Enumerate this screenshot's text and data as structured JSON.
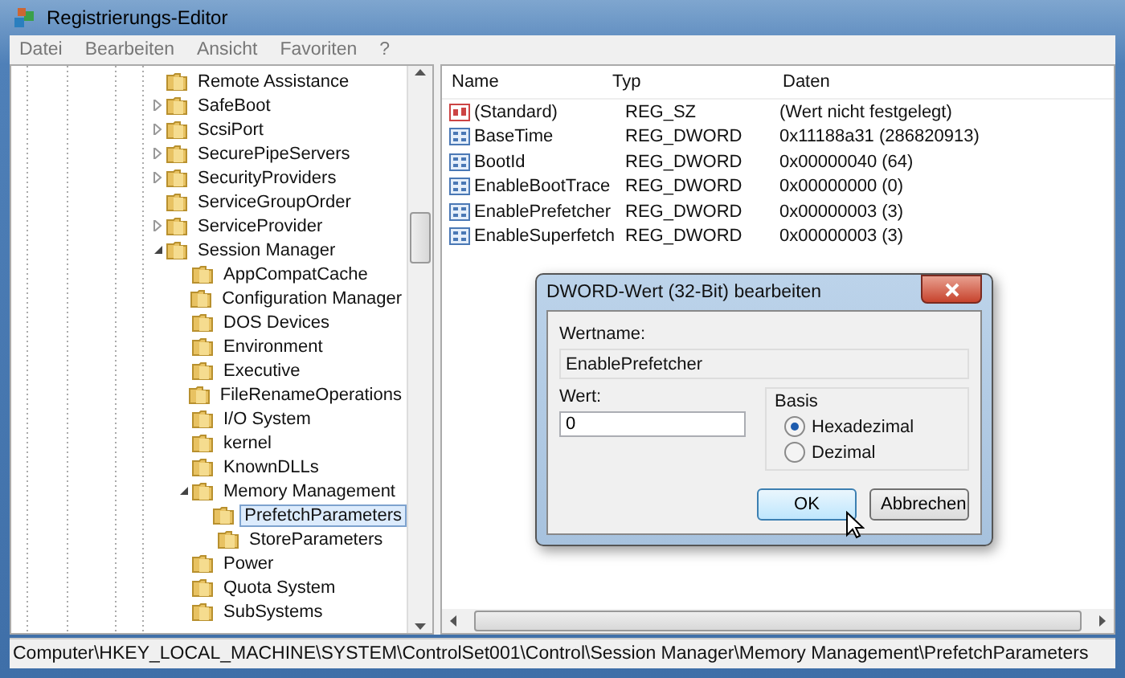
{
  "window": {
    "title": "Registrierungs-Editor"
  },
  "menu": [
    "Datei",
    "Bearbeiten",
    "Ansicht",
    "Favoriten",
    "?"
  ],
  "tree": [
    {
      "label": "Remote Assistance",
      "selected": false
    },
    {
      "label": "SafeBoot",
      "expanded": false,
      "selected": false
    },
    {
      "label": "ScsiPort",
      "expanded": false,
      "selected": false
    },
    {
      "label": "SecurePipeServers",
      "expanded": false,
      "selected": false
    },
    {
      "label": "SecurityProviders",
      "expanded": false,
      "selected": false
    },
    {
      "label": "ServiceGroupOrder",
      "selected": false
    },
    {
      "label": "ServiceProvider",
      "expanded": false,
      "selected": false
    },
    {
      "label": "Session Manager",
      "expanded": true,
      "selected": false,
      "children": [
        {
          "label": "AppCompatCache",
          "selected": false
        },
        {
          "label": "Configuration Manager",
          "selected": false
        },
        {
          "label": "DOS Devices",
          "selected": false
        },
        {
          "label": "Environment",
          "selected": false
        },
        {
          "label": "Executive",
          "selected": false
        },
        {
          "label": "FileRenameOperations",
          "selected": false
        },
        {
          "label": "I/O System",
          "selected": false
        },
        {
          "label": "kernel",
          "selected": false
        },
        {
          "label": "KnownDLLs",
          "selected": false
        },
        {
          "label": "Memory Management",
          "expanded": true,
          "selected": false,
          "children": [
            {
              "label": "PrefetchParameters",
              "selected": true
            },
            {
              "label": "StoreParameters",
              "selected": false
            }
          ]
        },
        {
          "label": "Power",
          "selected": false
        },
        {
          "label": "Quota System",
          "selected": false
        },
        {
          "label": "SubSystems",
          "selected": false
        }
      ]
    }
  ],
  "table": {
    "columns": [
      "Name",
      "Typ",
      "Daten"
    ],
    "rows": [
      {
        "kind": "string",
        "name": "(Standard)",
        "type": "REG_SZ",
        "data": "(Wert nicht festgelegt)"
      },
      {
        "kind": "dword",
        "name": "BaseTime",
        "type": "REG_DWORD",
        "data": "0x11188a31 (286820913)"
      },
      {
        "kind": "dword",
        "name": "BootId",
        "type": "REG_DWORD",
        "data": "0x00000040 (64)"
      },
      {
        "kind": "dword",
        "name": "EnableBootTrace",
        "type": "REG_DWORD",
        "data": "0x00000000 (0)"
      },
      {
        "kind": "dword",
        "name": "EnablePrefetcher",
        "type": "REG_DWORD",
        "data": "0x00000003 (3)"
      },
      {
        "kind": "dword",
        "name": "EnableSuperfetch",
        "type": "REG_DWORD",
        "data": "0x00000003 (3)"
      }
    ]
  },
  "dialog": {
    "title": "DWORD-Wert (32-Bit) bearbeiten",
    "name_label": "Wertname:",
    "name_value": "EnablePrefetcher",
    "value_label": "Wert:",
    "value": "0",
    "base_label": "Basis",
    "bases": [
      {
        "label": "Hexadezimal",
        "selected": true
      },
      {
        "label": "Dezimal",
        "selected": false
      }
    ],
    "buttons": [
      {
        "label": "OK",
        "default": true
      },
      {
        "label": "Abbrechen",
        "default": false
      }
    ]
  },
  "status_bar": "Computer\\HKEY_LOCAL_MACHINE\\SYSTEM\\ControlSet001\\Control\\Session Manager\\Memory Management\\PrefetchParameters"
}
